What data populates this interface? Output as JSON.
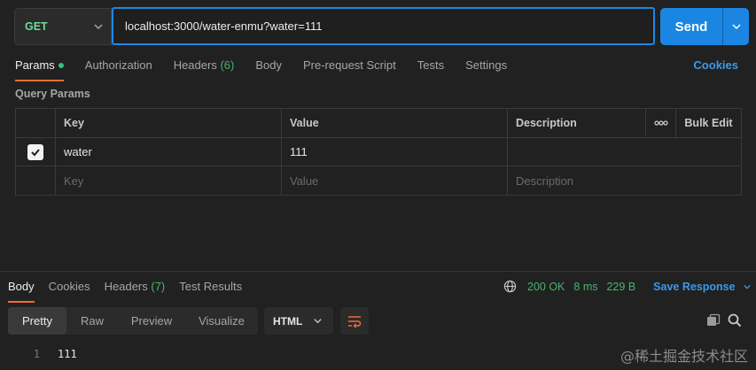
{
  "request": {
    "method": "GET",
    "url": "localhost:3000/water-enmu?water=111",
    "send_label": "Send"
  },
  "request_tabs": [
    {
      "label": "Params",
      "active": true
    },
    {
      "label": "Authorization"
    },
    {
      "label": "Headers",
      "count": "(6)"
    },
    {
      "label": "Body"
    },
    {
      "label": "Pre-request Script"
    },
    {
      "label": "Tests"
    },
    {
      "label": "Settings"
    }
  ],
  "cookies_label": "Cookies",
  "query_params": {
    "title": "Query Params",
    "headers": {
      "key": "Key",
      "value": "Value",
      "description": "Description",
      "more": "ooo",
      "bulk_edit": "Bulk Edit"
    },
    "rows": [
      {
        "checked": true,
        "key": "water",
        "value": "111",
        "description": ""
      }
    ],
    "placeholders": {
      "key": "Key",
      "value": "Value",
      "description": "Description"
    }
  },
  "response": {
    "tabs": [
      {
        "label": "Body",
        "active": true
      },
      {
        "label": "Cookies"
      },
      {
        "label": "Headers",
        "count": "(7)"
      },
      {
        "label": "Test Results"
      }
    ],
    "status": "200 OK",
    "time": "8 ms",
    "size": "229 B",
    "save_label": "Save Response",
    "view_modes": [
      "Pretty",
      "Raw",
      "Preview",
      "Visualize"
    ],
    "active_view": "Pretty",
    "format": "HTML",
    "lines": [
      {
        "number": "1",
        "text": "111"
      }
    ]
  },
  "watermark": "@稀土掘金技术社区",
  "colors": {
    "accent_blue": "#1b86e1",
    "get_green": "#6bdd9a",
    "tab_orange": "#f26b3a",
    "status_green": "#49b36b"
  }
}
